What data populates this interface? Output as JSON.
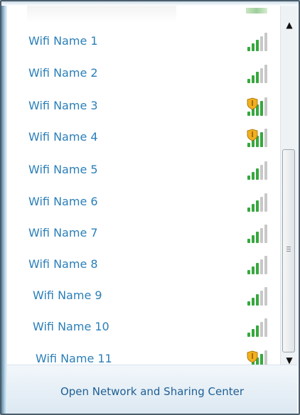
{
  "networks": [
    {
      "name": "Wifi Name 1",
      "secured_icon": "signal-strength-icon"
    },
    {
      "name": "Wifi Name 2",
      "secured_icon": "signal-strength-icon"
    },
    {
      "name": "Wifi Name 3",
      "secured_icon": "shield-signal-strength-icon"
    },
    {
      "name": "Wifi Name 4",
      "secured_icon": "shield-signal-strength-icon"
    },
    {
      "name": "Wifi Name 5",
      "secured_icon": "signal-strength-icon"
    },
    {
      "name": "Wifi Name 6",
      "secured_icon": "signal-strength-icon"
    },
    {
      "name": "Wifi Name 7",
      "secured_icon": "signal-strength-icon"
    },
    {
      "name": "Wifi Name 8",
      "secured_icon": "signal-strength-icon"
    },
    {
      "name": "Wifi Name 9",
      "secured_icon": "signal-strength-icon"
    },
    {
      "name": "Wifi Name 10",
      "secured_icon": "signal-strength-icon"
    },
    {
      "name": "Wifi Name 11",
      "secured_icon": "shield-signal-strength-icon"
    }
  ],
  "footer": {
    "link_label": "Open Network and Sharing Center"
  },
  "colors": {
    "network_text": "#2b7fb8",
    "footer_link": "#1f5f94",
    "signal_active": "#37a83e",
    "signal_inactive": "#c8c8c8",
    "shield": "#f0b020"
  }
}
